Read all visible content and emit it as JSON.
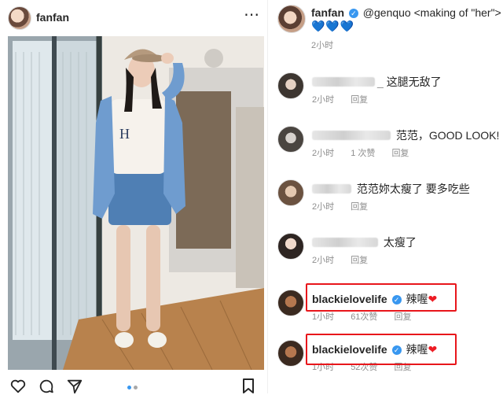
{
  "post": {
    "username": "fanfan",
    "more_icon": "more-horizontal-icon",
    "icons": [
      "heart-icon",
      "comment-icon",
      "share-icon",
      "bookmark-icon"
    ],
    "carousel": {
      "count": 2,
      "active": 1,
      "active_color": "#3897f0",
      "inactive_color": "#a8a8a8"
    }
  },
  "caption": {
    "username": "fanfan",
    "mention": "@genquo",
    "text": "<making of \"her\">",
    "hearts": "💙💙💙",
    "time": "2小时"
  },
  "comments": [
    {
      "username": "",
      "text": "这腿无敌了",
      "time": "2小时",
      "likes": "",
      "reply": "回复",
      "highlighted": false
    },
    {
      "username": "",
      "text": "范范，GOOD LOOK!",
      "time": "2小时",
      "likes": "1 次赞",
      "reply": "回复",
      "highlighted": false
    },
    {
      "username": "",
      "text": "范范妳太瘦了 要多吃些",
      "time": "2小时",
      "likes": "",
      "reply": "回复",
      "highlighted": false
    },
    {
      "username": "",
      "text": "太瘦了",
      "time": "2小时",
      "likes": "",
      "reply": "回复",
      "highlighted": false
    },
    {
      "username": "blackielovelife",
      "text": "辣喔",
      "time": "1小时",
      "likes": "61次赞",
      "reply": "回复",
      "highlighted": true
    },
    {
      "username": "blackielovelife",
      "text": "辣喔",
      "time": "1小时",
      "likes": "52次赞",
      "reply": "回复",
      "highlighted": true
    }
  ],
  "colors": {
    "highlight": "#e8161b",
    "link": "#262626",
    "meta": "#8e8e8e",
    "verified": "#3897f0"
  }
}
